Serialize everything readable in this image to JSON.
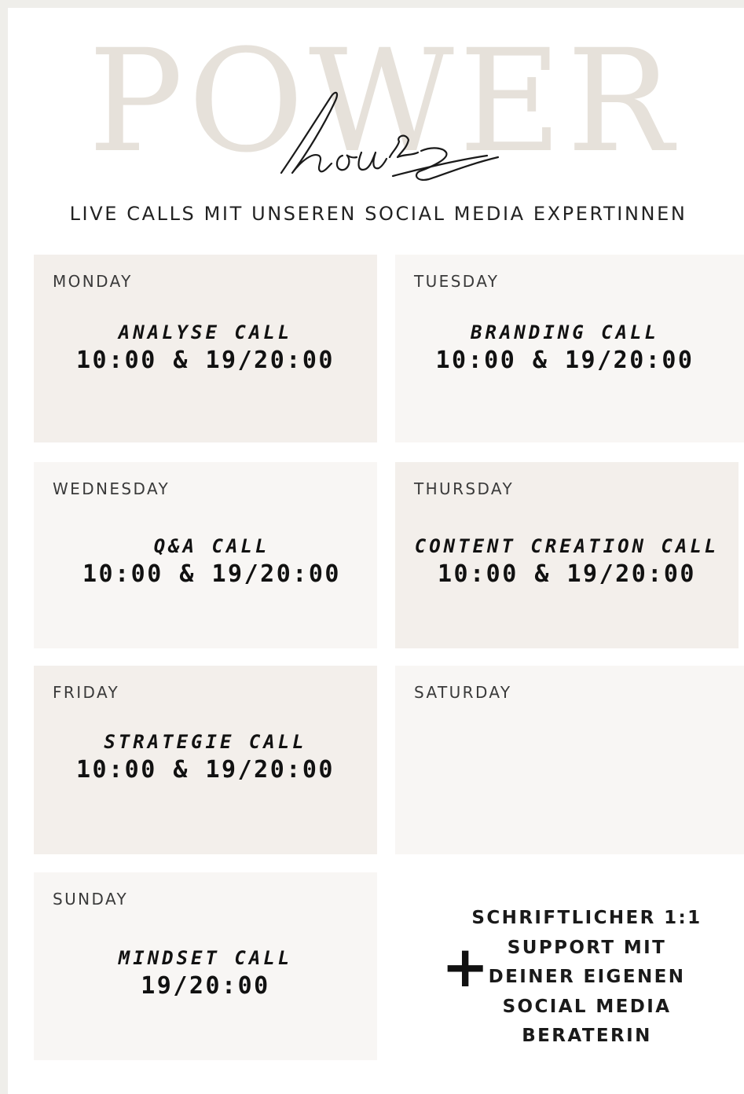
{
  "header": {
    "title_big": "POWER",
    "title_script": "hours",
    "subtitle": "LIVE CALLS MIT UNSEREN SOCIAL MEDIA EXPERTINNEN"
  },
  "colors": {
    "page_bg": "#ffffff",
    "outer_bg": "#efeeea",
    "cell_dark": "#f3efeb",
    "cell_light": "#f8f6f4",
    "power_text": "#e6e1da"
  },
  "days": [
    {
      "day": "MONDAY",
      "call": "ANALYSE CALL",
      "time": "10:00 & 19/20:00"
    },
    {
      "day": "TUESDAY",
      "call": "BRANDING CALL",
      "time": "10:00 & 19/20:00"
    },
    {
      "day": "WEDNESDAY",
      "call": "Q&A CALL",
      "time": "10:00 & 19/20:00"
    },
    {
      "day": "THURSDAY",
      "call": "CONTENT CREATION CALL",
      "time": "10:00 & 19/20:00"
    },
    {
      "day": "FRIDAY",
      "call": "STRATEGIE CALL",
      "time": "10:00 & 19/20:00"
    },
    {
      "day": "SATURDAY",
      "call": "",
      "time": ""
    },
    {
      "day": "SUNDAY",
      "call": "MINDSET CALL",
      "time": "19/20:00"
    }
  ],
  "extra": {
    "plus": "+",
    "lines": [
      "SCHRIFTLICHER 1:1",
      "SUPPORT MIT",
      "DEINER EIGENEN",
      "SOCIAL MEDIA",
      "BERATERIN"
    ]
  }
}
